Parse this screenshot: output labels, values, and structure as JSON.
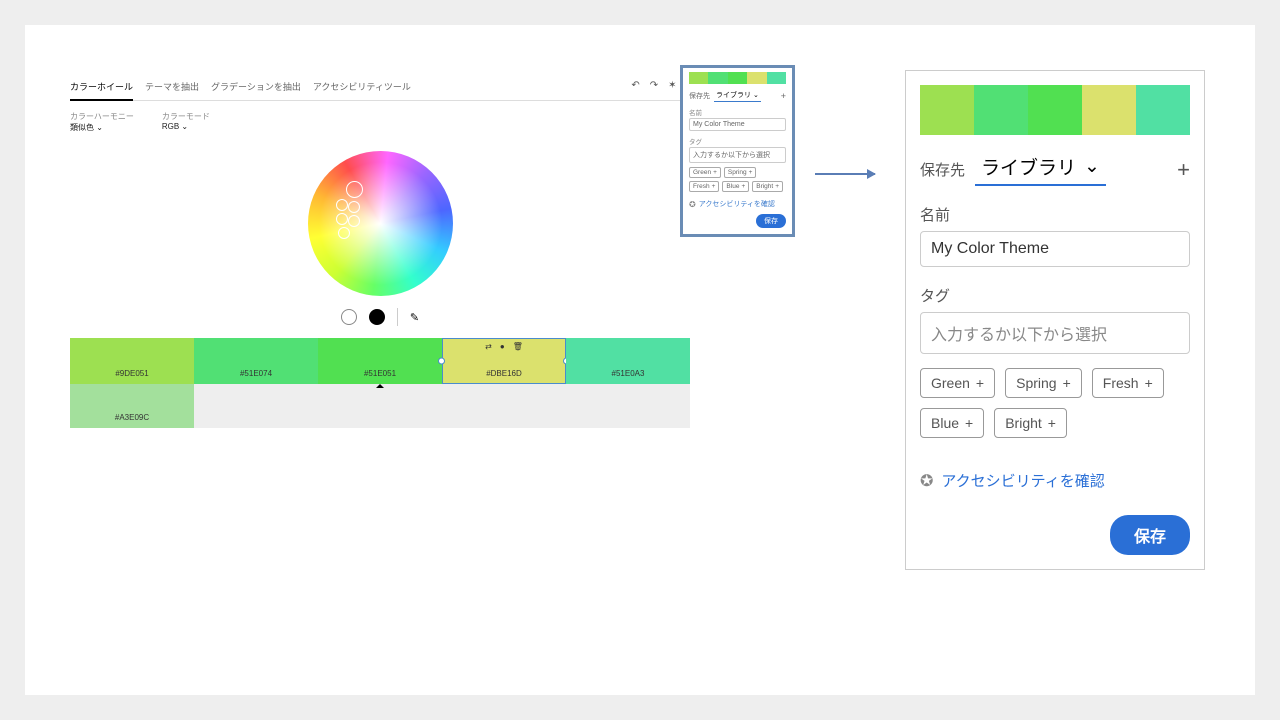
{
  "tabs": {
    "wheel": "カラーホイール",
    "extract": "テーマを抽出",
    "grad": "グラデーションを抽出",
    "a11y": "アクセシビリティツール"
  },
  "selectors": {
    "harmonyLabel": "カラーハーモニー",
    "harmonyValue": "類似色",
    "modeLabel": "カラーモード",
    "modeValue": "RGB"
  },
  "swatches": [
    {
      "hex": "#9DE051",
      "label": "#9DE051"
    },
    {
      "hex": "#51E074",
      "label": "#51E074"
    },
    {
      "hex": "#51E051",
      "label": "#51E051"
    },
    {
      "hex": "#DBE16D",
      "label": "#DBE16D"
    },
    {
      "hex": "#51E0A3",
      "label": "#51E0A3"
    }
  ],
  "swatch2": {
    "hex": "#A3E09C",
    "label": "#A3E09C"
  },
  "panel": {
    "saveToLabel": "保存先",
    "saveToValue": "ライブラリ",
    "nameLabel": "名前",
    "nameValue": "My Color Theme",
    "tagLabel": "タグ",
    "tagPlaceholder": "入力するか以下から選択",
    "tags": [
      "Green",
      "Spring",
      "Fresh",
      "Blue",
      "Bright"
    ],
    "a11yLink": "アクセシビリティを確認",
    "saveBtn": "保存"
  }
}
